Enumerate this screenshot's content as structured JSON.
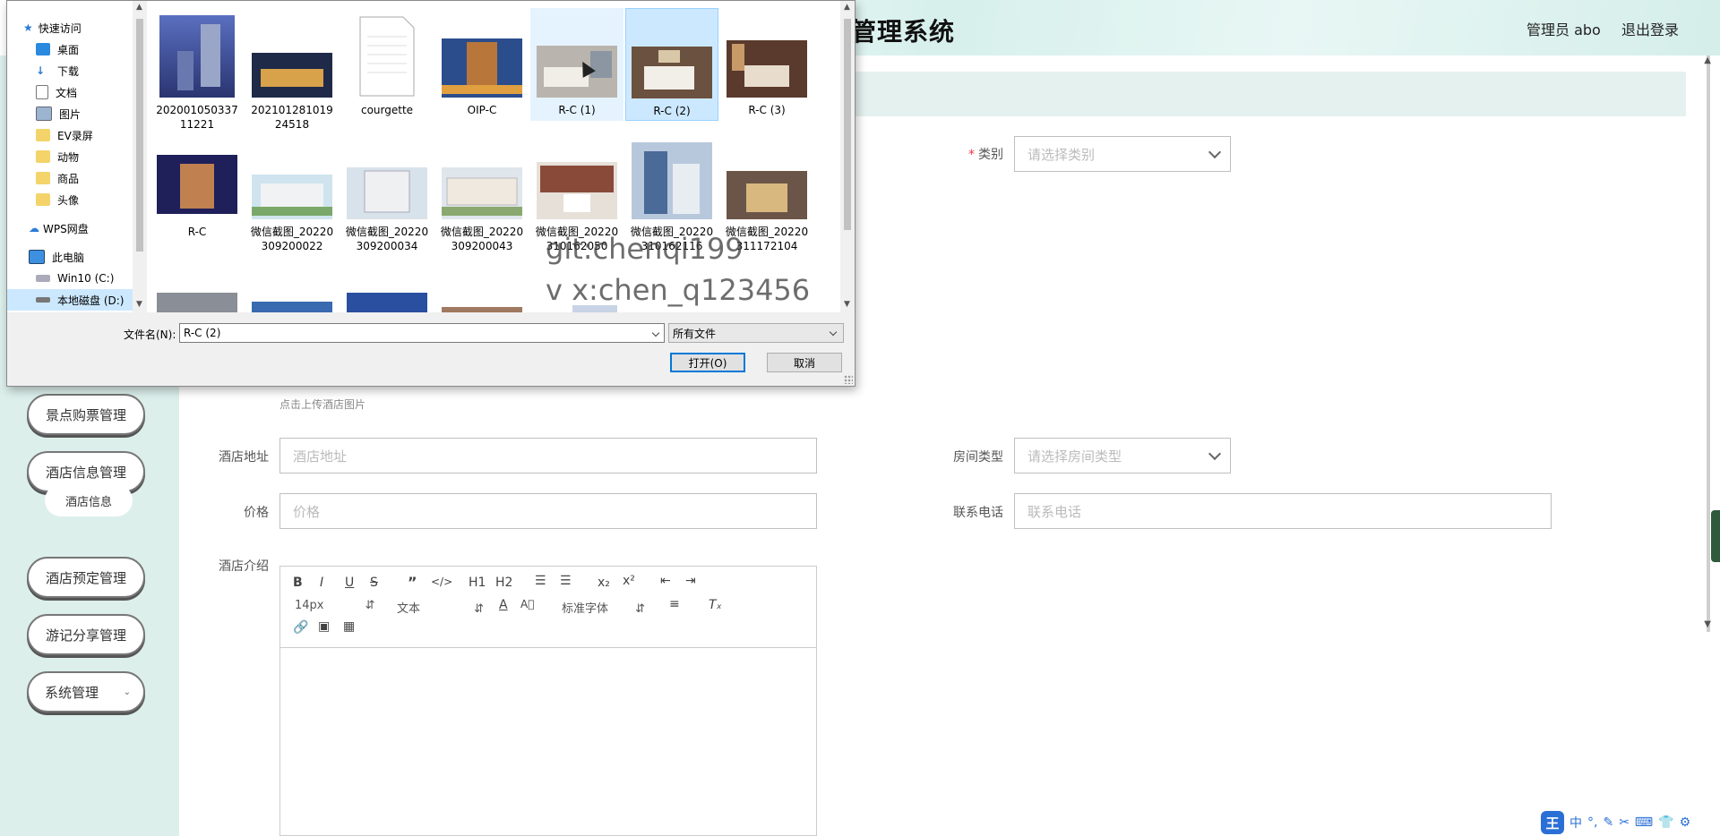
{
  "app": {
    "title": "管理系统",
    "admin_label": "管理员 abo",
    "logout_label": "退出登录"
  },
  "sidebar": {
    "items": [
      {
        "label": "景点购票管理"
      },
      {
        "label": "酒店信息管理"
      },
      {
        "label": "酒店信息"
      },
      {
        "label": "酒店预定管理"
      },
      {
        "label": "游记分享管理"
      },
      {
        "label": "系统管理"
      }
    ]
  },
  "form": {
    "category_label": "类别",
    "category_placeholder": "请选择类别",
    "upload_hint": "点击上传酒店图片",
    "address_label": "酒店地址",
    "address_placeholder": "酒店地址",
    "room_type_label": "房间类型",
    "room_type_placeholder": "请选择房间类型",
    "price_label": "价格",
    "price_placeholder": "价格",
    "phone_label": "联系电话",
    "phone_placeholder": "联系电话",
    "intro_label": "酒店介绍"
  },
  "editor": {
    "font_size": "14px",
    "text_style": "文本",
    "font_family": "标准字体",
    "h1": "H1",
    "h2": "H2",
    "bold": "B",
    "italic": "I",
    "underline": "U",
    "strike": "S",
    "sub": "x₂",
    "sup": "x²"
  },
  "ime": {
    "logo": "王",
    "items": [
      "中",
      "°,",
      "✎",
      "✂",
      "⌨",
      "👕",
      "⚙"
    ]
  },
  "dialog": {
    "nav": [
      {
        "label": "快速访问",
        "icon": "star-icon"
      },
      {
        "label": "桌面",
        "icon": "desktop-icon",
        "pinned": true
      },
      {
        "label": "下载",
        "icon": "download-icon",
        "pinned": true
      },
      {
        "label": "文档",
        "icon": "document-icon",
        "pinned": true
      },
      {
        "label": "图片",
        "icon": "picture-icon",
        "pinned": true
      },
      {
        "label": "EV录屏",
        "icon": "folder-icon"
      },
      {
        "label": "动物",
        "icon": "folder-icon"
      },
      {
        "label": "商品",
        "icon": "folder-icon"
      },
      {
        "label": "头像",
        "icon": "folder-icon"
      },
      {
        "label": "WPS网盘",
        "icon": "cloud-icon"
      },
      {
        "label": "此电脑",
        "icon": "computer-icon"
      },
      {
        "label": "Win10 (C:)",
        "icon": "drive-icon"
      },
      {
        "label": "本地磁盘 (D:)",
        "icon": "drive-icon"
      }
    ],
    "files": [
      {
        "name": "20200105033711221"
      },
      {
        "name": "20210128101924518"
      },
      {
        "name": "courgette"
      },
      {
        "name": "OIP-C"
      },
      {
        "name": "R-C (1)"
      },
      {
        "name": "R-C (2)"
      },
      {
        "name": "R-C (3)"
      },
      {
        "name": "R-C"
      },
      {
        "name": "微信截图_20220309200022"
      },
      {
        "name": "微信截图_20220309200034"
      },
      {
        "name": "微信截图_20220309200043"
      },
      {
        "name": "微信截图_20220310162050"
      },
      {
        "name": "微信截图_20220310162116"
      },
      {
        "name": "微信截图_20220311172104"
      }
    ],
    "filename_label": "文件名(N):",
    "filename_value": "R-C (2)",
    "filetype_value": "所有文件",
    "open_label": "打开(O)",
    "cancel_label": "取消"
  },
  "watermark": {
    "line1": "git:chenqi199",
    "line2": "v x:chen_q123456"
  },
  "colors": {
    "sidebar_bg": "#dcefeb",
    "content_bar": "#e4f1ef",
    "dialog_selection": "#cce8ff",
    "ime_blue": "#2a6fd6"
  }
}
